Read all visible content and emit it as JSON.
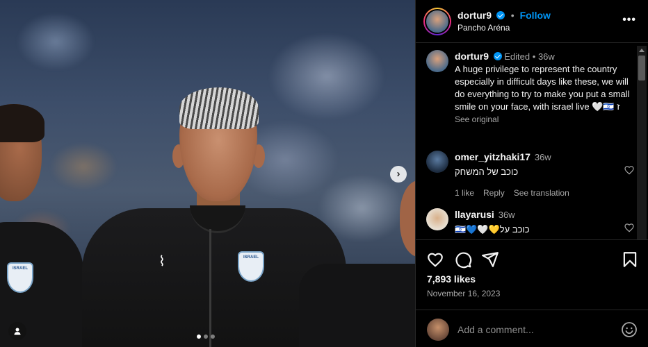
{
  "post": {
    "username": "dortur9",
    "follow_label": "Follow",
    "separator": "•",
    "location": "Pancho Aréna",
    "more_label": "•••"
  },
  "media": {
    "next_arrow": "›",
    "carousel_dots": 3,
    "active_dot": 1,
    "crest_text": "ISRAEL",
    "brand_mark": "⌇"
  },
  "caption": {
    "username": "dortur9",
    "edited": "Edited",
    "separator": "•",
    "time": "36w",
    "text": "A huge privilege to represent the country especially in difficult days like these, we will do everything to try to make you put a small smile on your face, with israel live 🤍🇮🇱 ז",
    "see_original": "See original"
  },
  "comments": [
    {
      "username": "omer_yitzhaki17",
      "time": "36w",
      "text": "כוכב של המשחק",
      "likes": "1 like",
      "reply": "Reply",
      "see_translation": "See translation"
    },
    {
      "username": "llayarusi",
      "time": "36w",
      "text": "כוכב על💛🤍💙🇮🇱"
    }
  ],
  "actions": {
    "likes": "7,893 likes",
    "date": "November 16, 2023"
  },
  "add_comment": {
    "placeholder": "Add a comment..."
  },
  "icons": {
    "heart": "heart-icon",
    "comment": "comment-icon",
    "share": "share-icon",
    "save": "bookmark-icon",
    "emoji": "emoji-icon",
    "user_tag": "user-tag-icon"
  },
  "colors": {
    "accent": "#0095f6",
    "background": "#000000",
    "text": "#f5f5f5",
    "secondary_text": "#a8a8a8",
    "divider": "#262626"
  }
}
